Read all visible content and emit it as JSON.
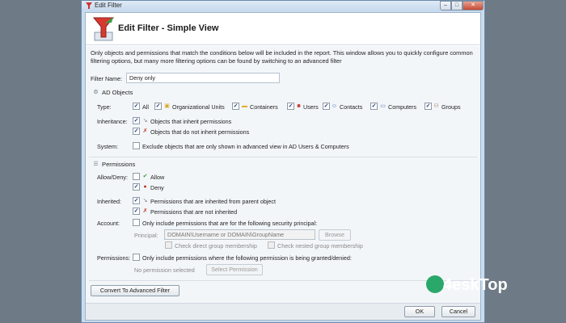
{
  "window": {
    "title": "Edit Filter",
    "buttons": {
      "min": "–",
      "max": "□",
      "close": "✕"
    }
  },
  "header": {
    "title": "Edit Filter - Simple View"
  },
  "description": "Only objects and permissions that match the conditions below will be included in the report. This window allows you to quickly configure common filtering options, but many more filtering options can be found by switching to an advanced filter",
  "filter_name": {
    "label": "Filter Name:",
    "value": "Deny only"
  },
  "ad_objects": {
    "heading": "AD Objects",
    "type_label": "Type:",
    "types": [
      {
        "label": "All",
        "checked": true,
        "icon": ""
      },
      {
        "label": "Organizational Units",
        "checked": true,
        "icon": "▣"
      },
      {
        "label": "Containers",
        "checked": true,
        "icon": "▬"
      },
      {
        "label": "Users",
        "checked": true,
        "icon": "☻"
      },
      {
        "label": "Contacts",
        "checked": true,
        "icon": "☺"
      },
      {
        "label": "Computers",
        "checked": true,
        "icon": "▭"
      },
      {
        "label": "Groups",
        "checked": true,
        "icon": "⚇"
      }
    ],
    "inheritance_label": "Inheritance:",
    "inheritance": [
      {
        "label": "Objects that inherit permissions",
        "checked": true,
        "icon": "↘"
      },
      {
        "label": "Objects that do not inherit permissions",
        "checked": true,
        "icon": "✗"
      }
    ],
    "system_label": "System:",
    "system_option": {
      "label": "Exclude objects that are only shown in advanced view in AD Users & Computers",
      "checked": false
    }
  },
  "permissions": {
    "heading": "Permissions",
    "allow_deny_label": "Allow/Deny:",
    "allow": {
      "label": "Allow",
      "checked": false,
      "icon": "✔"
    },
    "deny": {
      "label": "Deny",
      "checked": true,
      "icon": "●"
    },
    "inherited_label": "Inherited:",
    "inherited": [
      {
        "label": "Permissions that are inherited from parent object",
        "checked": true,
        "icon": "↘"
      },
      {
        "label": "Permissions that are not inherited",
        "checked": true,
        "icon": "✗"
      }
    ],
    "account_label": "Account:",
    "account_option": {
      "label": "Only include permissions that are for the following security principal:",
      "checked": false
    },
    "principal_label": "Principal:",
    "principal_placeholder": "DOMAIN\\Username or DOMAIN\\GroupName",
    "browse_label": "Browse",
    "check_direct": "Check direct group membership",
    "check_nested": "Check nested group membership",
    "permissions_label": "Permissions:",
    "perm_option": {
      "label": "Only include permissions where the following permission is being granted/denied:",
      "checked": false
    },
    "no_perm_selected": "No permission selected",
    "select_perm_label": "Select Permission"
  },
  "convert_button": "Convert To Advanced Filter",
  "ok_button": "OK",
  "cancel_button": "Cancel",
  "watermark": "4eskTop"
}
